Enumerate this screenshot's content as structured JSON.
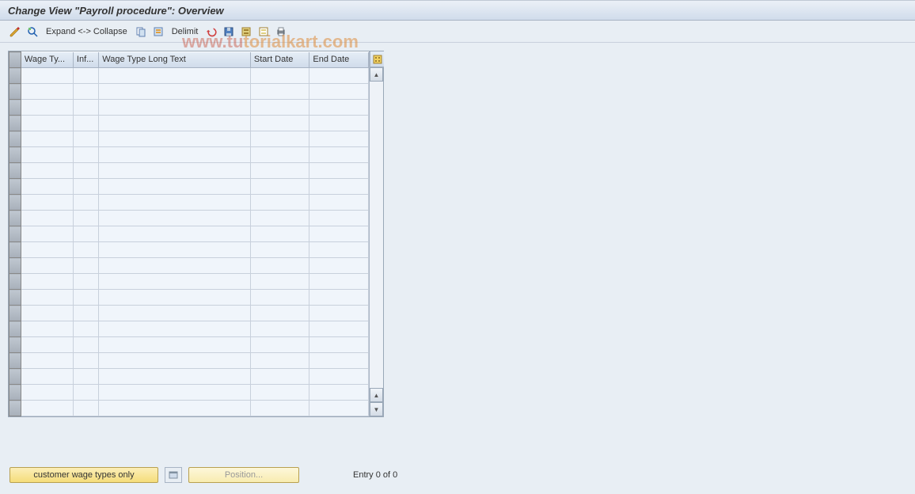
{
  "header": {
    "title": "Change View \"Payroll procedure\": Overview"
  },
  "toolbar": {
    "expand_collapse_label": "Expand <-> Collapse",
    "delimit_label": "Delimit"
  },
  "table": {
    "columns": {
      "wage_type": "Wage Ty...",
      "infotype": "Inf...",
      "long_text": "Wage Type Long Text",
      "start_date": "Start Date",
      "end_date": "End Date"
    },
    "row_count": 22
  },
  "footer": {
    "customer_wage_btn": "customer wage types only",
    "position_btn": "Position...",
    "entry_text": "Entry 0 of 0"
  },
  "watermark": {
    "part1": "www.tu",
    "part2": "torialkart.com"
  }
}
